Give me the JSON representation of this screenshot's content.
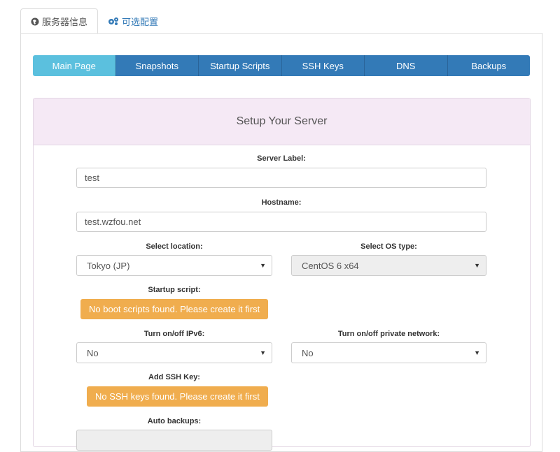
{
  "tabs": {
    "server_info": "服务器信息",
    "optional_config": "可选配置"
  },
  "nav": [
    "Main Page",
    "Snapshots",
    "Startup Scripts",
    "SSH Keys",
    "DNS",
    "Backups"
  ],
  "setup": {
    "title": "Setup Your Server",
    "server_label": {
      "label": "Server Label:",
      "value": "test"
    },
    "hostname": {
      "label": "Hostname:",
      "value": "test.wzfou.net"
    },
    "location": {
      "label": "Select location:",
      "value": "Tokyo (JP)"
    },
    "os_type": {
      "label": "Select OS type:",
      "value": "CentOS 6 x64"
    },
    "startup_script": {
      "label": "Startup script:",
      "message": "No boot scripts found. Please create it first"
    },
    "ipv6": {
      "label": "Turn on/off IPv6:",
      "value": "No"
    },
    "private_network": {
      "label": "Turn on/off private network:",
      "value": "No"
    },
    "ssh_key": {
      "label": "Add SSH Key:",
      "message": "No SSH keys found. Please create it first"
    },
    "auto_backups": {
      "label": "Auto backups:",
      "value": ""
    }
  },
  "colors": {
    "primary": "#337ab7",
    "active_nav": "#5bc0de",
    "warning": "#f0ad4e",
    "header_bg": "#f5e9f5"
  }
}
